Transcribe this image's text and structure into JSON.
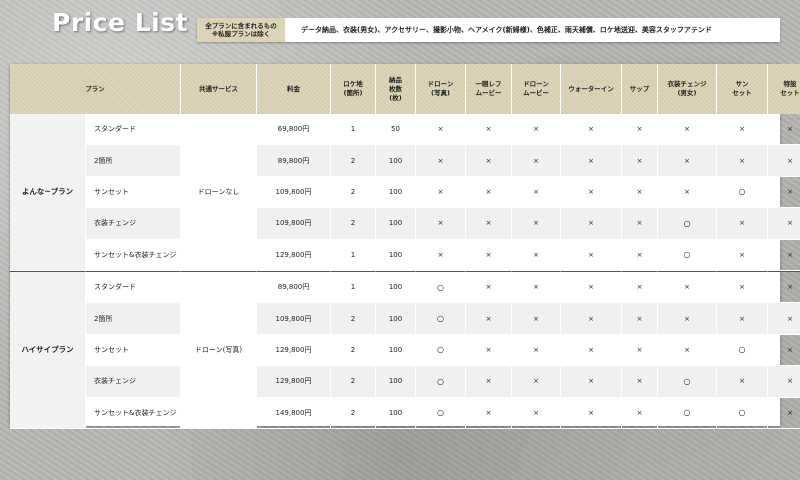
{
  "title": "Price List",
  "banner": {
    "label_line1": "全プランに含まれるもの",
    "label_line2": "※私服プランは除く",
    "text": "データ納品、衣装(男女)、アクセサリー、撮影小物、ヘアメイク(新婦様)、色補正、雨天補償、ロケ地送迎、美容スタッフアテンド"
  },
  "table": {
    "headers": [
      "プラン",
      "共通サービス",
      "料金",
      "ロケ地\n(箇所)",
      "納品\n枚数\n(枚)",
      "ドローン\n(写真)",
      "一眼レフ\nムービー",
      "ドローン\nムービー",
      "ウォーターイン",
      "サップ",
      "衣装チェンジ\n(男女)",
      "サン\nセット",
      "特設\nセット"
    ],
    "groups": [
      {
        "plan": "よんな~プラン",
        "service": "ドローンなし",
        "rows": [
          {
            "variant": "スタンダード",
            "price": "69,800円",
            "loc": "1",
            "count": "50",
            "marks": [
              "×",
              "×",
              "×",
              "×",
              "×",
              "×",
              "×",
              "×"
            ]
          },
          {
            "variant": "2箇所",
            "price": "89,800円",
            "loc": "2",
            "count": "100",
            "marks": [
              "×",
              "×",
              "×",
              "×",
              "×",
              "×",
              "×",
              "×"
            ]
          },
          {
            "variant": "サンセット",
            "price": "109,800円",
            "loc": "2",
            "count": "100",
            "marks": [
              "×",
              "×",
              "×",
              "×",
              "×",
              "×",
              "○",
              "×"
            ]
          },
          {
            "variant": "衣装チェンジ",
            "price": "109,800円",
            "loc": "2",
            "count": "100",
            "marks": [
              "×",
              "×",
              "×",
              "×",
              "×",
              "○",
              "×",
              "×"
            ]
          },
          {
            "variant": "サンセット&衣装チェンジ",
            "price": "129,800円",
            "loc": "1",
            "count": "100",
            "marks": [
              "×",
              "×",
              "×",
              "×",
              "×",
              "○",
              "×",
              "×"
            ]
          }
        ]
      },
      {
        "plan": "ハイサイプラン",
        "service": "ドローン(写真)",
        "rows": [
          {
            "variant": "スタンダード",
            "price": "89,800円",
            "loc": "1",
            "count": "100",
            "marks": [
              "○",
              "×",
              "×",
              "×",
              "×",
              "×",
              "×",
              "×"
            ]
          },
          {
            "variant": "2箇所",
            "price": "109,800円",
            "loc": "2",
            "count": "100",
            "marks": [
              "○",
              "×",
              "×",
              "×",
              "×",
              "×",
              "×",
              "×"
            ]
          },
          {
            "variant": "サンセット",
            "price": "129,800円",
            "loc": "2",
            "count": "100",
            "marks": [
              "○",
              "×",
              "×",
              "×",
              "×",
              "×",
              "○",
              "×"
            ]
          },
          {
            "variant": "衣装チェンジ",
            "price": "129,800円",
            "loc": "2",
            "count": "100",
            "marks": [
              "○",
              "×",
              "×",
              "×",
              "×",
              "○",
              "×",
              "×"
            ]
          },
          {
            "variant": "サンセット&衣装チェンジ",
            "price": "149,800円",
            "loc": "2",
            "count": "100",
            "marks": [
              "○",
              "×",
              "×",
              "×",
              "×",
              "○",
              "○",
              "×"
            ]
          }
        ]
      }
    ]
  }
}
